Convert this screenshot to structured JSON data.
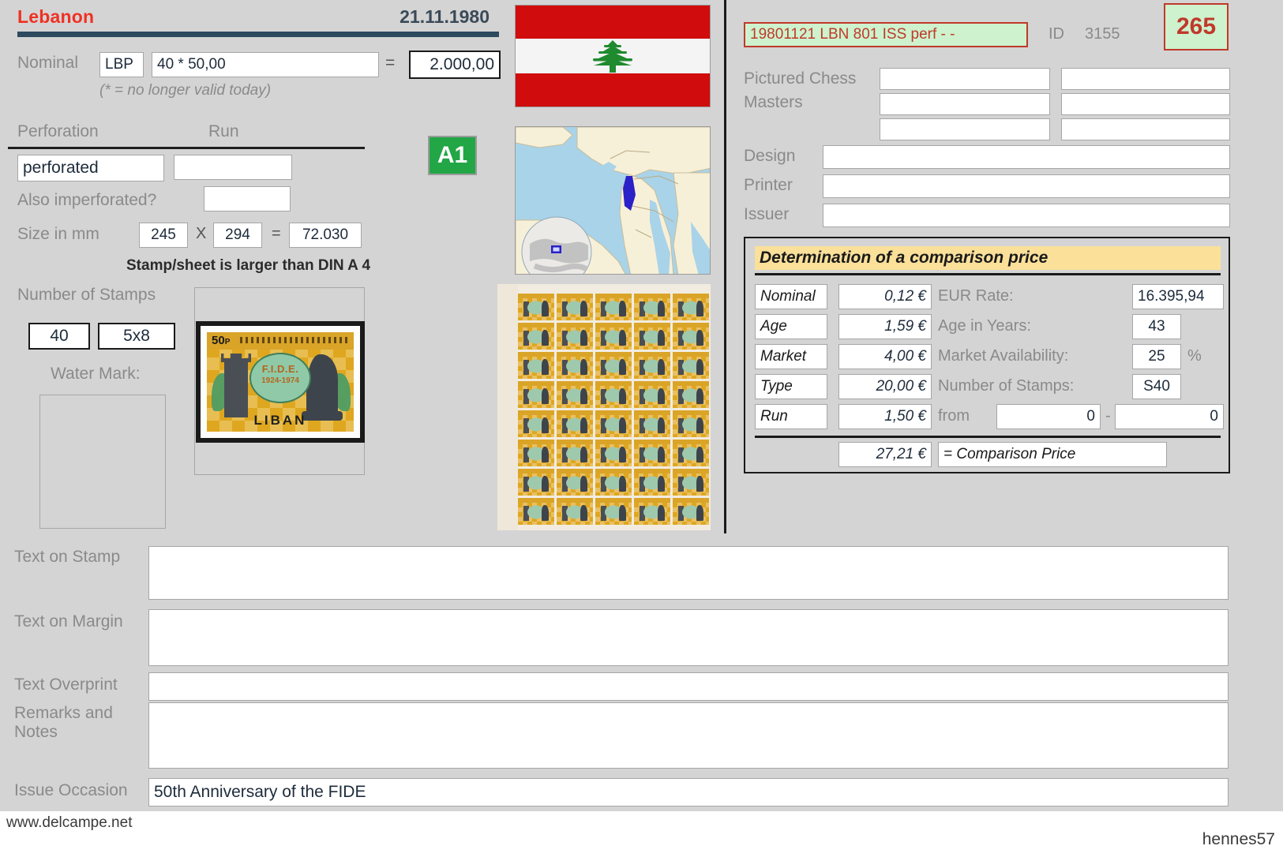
{
  "header": {
    "country": "Lebanon",
    "issue_date": "21.11.1980"
  },
  "nominal": {
    "label": "Nominal",
    "currency": "LBP",
    "expression": "40 * 50,00",
    "equals_sign": "=",
    "total": "2.000,00",
    "note": "(* = no longer valid today)"
  },
  "perforation": {
    "perforation_label": "Perforation",
    "run_label": "Run",
    "perforation_value": "perforated",
    "run_value": "",
    "also_imperforated_label": "Also imperforated?",
    "also_imperforated_value": ""
  },
  "size": {
    "label": "Size in mm",
    "width": "245",
    "x_sign": "X",
    "height": "294",
    "equals_sign": "=",
    "area": "72.030",
    "note": "Stamp/sheet is larger than DIN A 4"
  },
  "stamps": {
    "label": "Number of Stamps",
    "count": "40",
    "grid": "5x8",
    "watermark_label": "Water Mark:",
    "watermark_value": ""
  },
  "stamp_image": {
    "denomination": "50",
    "denomination_unit": "P",
    "org": "F.I.D.E.",
    "years": "1924-1974",
    "country_name": "LIBAN"
  },
  "badges": {
    "quality": "A1"
  },
  "right": {
    "catalog_code": "19801121 LBN 801 ISS perf - -",
    "id_label": "ID",
    "id_value": "3155",
    "rank": "265",
    "pictured_chess_masters_label_line1": "Pictured Chess",
    "pictured_chess_masters_label_line2": "Masters",
    "pictured_chess_masters": [
      "",
      "",
      "",
      "",
      "",
      ""
    ],
    "design_label": "Design",
    "design_value": "",
    "printer_label": "Printer",
    "printer_value": "",
    "issuer_label": "Issuer",
    "issuer_value": ""
  },
  "comparison": {
    "title": "Determination of a comparison price",
    "rows": [
      {
        "name": "Nominal",
        "value": "0,12 €",
        "label": "EUR Rate:",
        "field": "16.395,94",
        "suffix": ""
      },
      {
        "name": "Age",
        "value": "1,59 €",
        "label": "Age in Years:",
        "field": "43",
        "suffix": ""
      },
      {
        "name": "Market",
        "value": "4,00 €",
        "label": "Market Availability:",
        "field": "25",
        "suffix": "%"
      },
      {
        "name": "Type",
        "value": "20,00 €",
        "label": "Number of Stamps:",
        "field": "S40",
        "suffix": ""
      },
      {
        "name": "Run",
        "value": "1,50 €",
        "label": "from",
        "field": "0",
        "suffix": ""
      }
    ],
    "range_separator": "-",
    "range_to": "0",
    "total_value": "27,21 €",
    "total_label": "= Comparison Price"
  },
  "texts": {
    "text_on_stamp_label": "Text on Stamp",
    "text_on_stamp_value": "",
    "text_on_margin_label": "Text on Margin",
    "text_on_margin_value": "",
    "text_overprint_label": "Text Overprint",
    "text_overprint_value": "",
    "remarks_label_line1": "Remarks and",
    "remarks_label_line2": "Notes",
    "remarks_value": "",
    "issue_occasion_label": "Issue Occasion",
    "issue_occasion_value": "50th Anniversary of the FIDE"
  },
  "footer": {
    "left": "www.delcampe.net",
    "right": "hennes57"
  },
  "colors": {
    "accent_red": "#ef3124",
    "rule_navy": "#2e4a5e",
    "badge_green": "#22a646",
    "panel_yellow": "#fbe09a",
    "code_green_bg": "#cdf2cd",
    "code_red": "#c0392b",
    "flag_red": "#d00c0c",
    "cedar_green": "#1f8a2e"
  }
}
